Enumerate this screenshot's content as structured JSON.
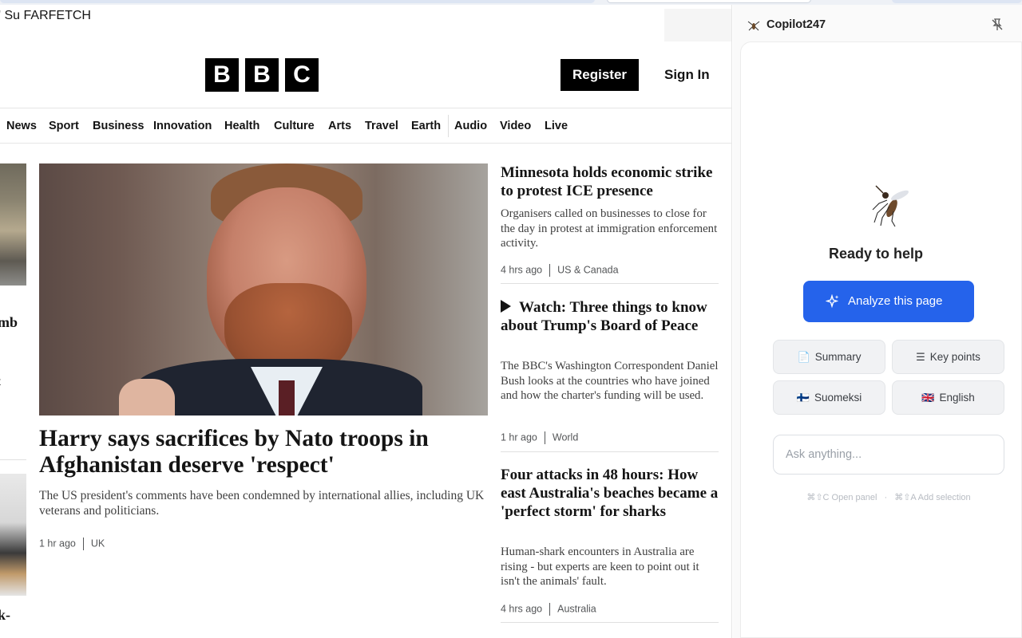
{
  "browser": {},
  "bbc": {
    "promo_text": "' Su FARFETCH",
    "logo_letters": [
      "B",
      "B",
      "C"
    ],
    "register_label": "Register",
    "signin_label": "Sign In",
    "nav": [
      "News",
      "Sport",
      "Business",
      "Innovation",
      "Health",
      "Culture",
      "Arts",
      "Travel",
      "Earth",
      "Audio",
      "Video",
      "Live"
    ],
    "edge_texts": [
      "mb",
      "t",
      "k-"
    ],
    "hero": {
      "title": "Harry says sacrifices by Nato troops in Afghanistan deserve 'respect'",
      "summary": "The US president's comments have been condemned by international allies, including UK veterans and politicians.",
      "time": "1 hr ago",
      "tag": "UK"
    },
    "stories": [
      {
        "title": "Minnesota holds economic strike to protest ICE presence",
        "summary": "Organisers called on businesses to close for the day in protest at immigration enforcement activity.",
        "time": "4 hrs ago",
        "tag": "US & Canada",
        "video": false
      },
      {
        "title": "Watch: Three things to know about Trump's Board of Peace",
        "summary": "The BBC's Washington Correspondent Daniel Bush looks at the countries who have joined and how the charter's funding will be used.",
        "time": "1 hr ago",
        "tag": "World",
        "video": true
      },
      {
        "title": "Four attacks in 48 hours: How east Australia's beaches became a 'perfect storm' for sharks",
        "summary": "Human-shark encounters in Australia are rising - but experts are keen to point out it isn't the animals' fault.",
        "time": "4 hrs ago",
        "tag": "Australia",
        "video": false
      }
    ]
  },
  "copilot": {
    "title": "Copilot247",
    "logo_icon": "mosquito-icon",
    "status": "Ready to help",
    "analyze_label": "Analyze this page",
    "chips": [
      {
        "label": "Summary",
        "icon": "📄"
      },
      {
        "label": "Key points",
        "icon": "☰"
      },
      {
        "label": "Suomeksi",
        "icon": "🇫🇮"
      },
      {
        "label": "English",
        "icon": "🇬🇧"
      }
    ],
    "ask_placeholder": "Ask anything...",
    "shortcut_open": "⌘⇧C Open panel",
    "shortcut_sep": "·",
    "shortcut_add": "⌘⇧A Add selection",
    "accent": "#2563eb"
  }
}
